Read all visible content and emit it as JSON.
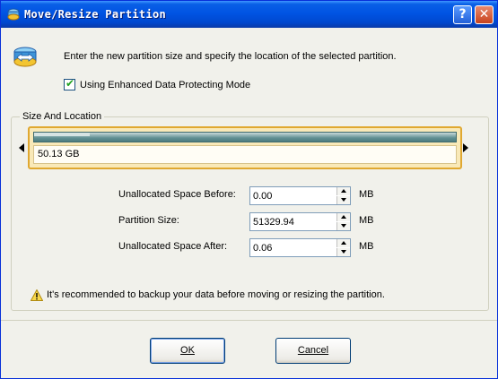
{
  "window": {
    "title": "Move/Resize Partition",
    "help_label": "?",
    "close_label": "✕"
  },
  "instruction": "Enter the new partition size and specify the location of the selected partition.",
  "enhanced_mode": {
    "label": "Using Enhanced Data Protecting Mode",
    "checked": true,
    "mark": "✔"
  },
  "size_and_location": {
    "legend": "Size And Location",
    "partition_size_text": "50.13 GB"
  },
  "fields": [
    {
      "label": "Unallocated Space Before:",
      "value": "0.00",
      "unit": "MB"
    },
    {
      "label": "Partition Size:",
      "value": "51329.94",
      "unit": "MB"
    },
    {
      "label": "Unallocated Space After:",
      "value": "0.06",
      "unit": "MB"
    }
  ],
  "warning": "It's recommended to backup your data before moving or resizing the partition.",
  "buttons": {
    "ok": "OK",
    "cancel": "Cancel"
  },
  "colors": {
    "titlebar": "#0054e3",
    "partition_border": "#e0a830",
    "partition_bar": "#5f8f92"
  }
}
